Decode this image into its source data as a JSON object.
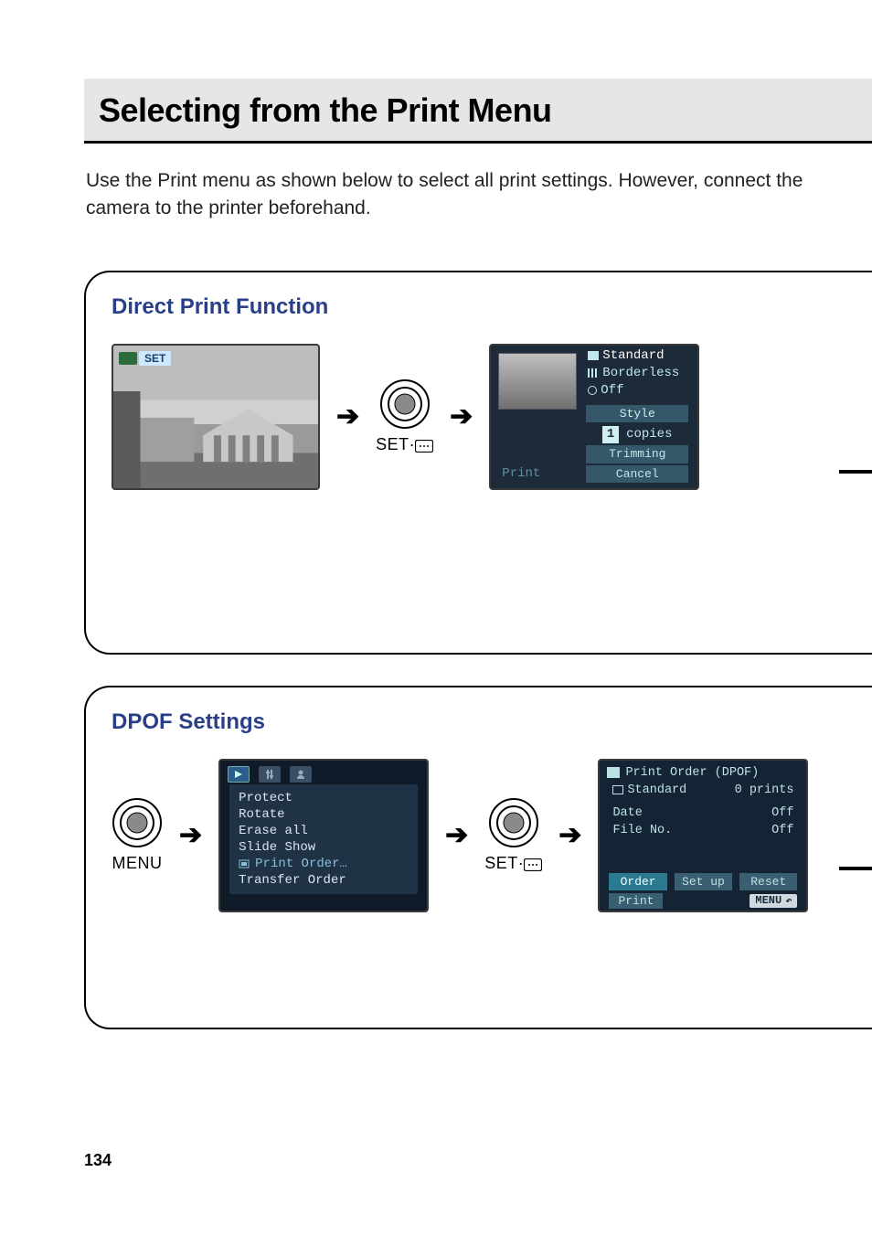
{
  "page": {
    "title": "Selecting from the Print Menu",
    "intro": "Use the Print menu as shown below to select all print settings. However, connect the camera to the printer beforehand.",
    "number": "134"
  },
  "panel_direct": {
    "title": "Direct Print Function",
    "set_badge": "SET",
    "button_label": "SET",
    "print_screen": {
      "options": {
        "standard": "Standard",
        "borderless": "Borderless",
        "off": "Off"
      },
      "style": "Style",
      "copies_label": "copies",
      "copies_value": "1",
      "trimming": "Trimming",
      "cancel": "Cancel",
      "print": "Print"
    }
  },
  "panel_dpof": {
    "title": "DPOF Settings",
    "menu_button_label": "MENU",
    "set_button_label": "SET",
    "menu_screen": {
      "items": [
        "Protect",
        "Rotate",
        "Erase all",
        "Slide Show",
        "Print Order…",
        "Transfer Order"
      ]
    },
    "dpof_screen": {
      "header": "Print Order (DPOF)",
      "standard_label": "Standard",
      "standard_value": "0 prints",
      "rows": [
        {
          "label": "Date",
          "value": "Off"
        },
        {
          "label": "File No.",
          "value": "Off"
        }
      ],
      "buttons": {
        "order": "Order",
        "setup": "Set up",
        "reset": "Reset"
      },
      "print": "Print",
      "menu_badge": "MENU"
    }
  }
}
